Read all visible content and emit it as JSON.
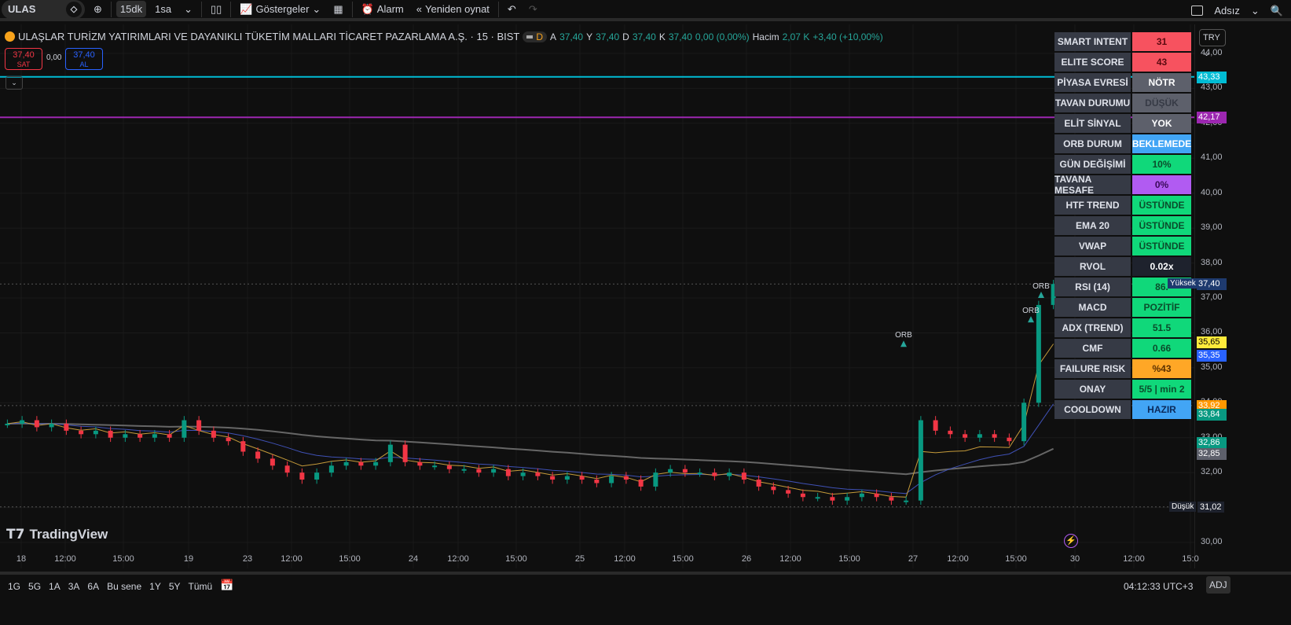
{
  "toolbar": {
    "symbol": "ULAS",
    "interval_active": "15dk",
    "interval_2": "1sa",
    "indicators": "Göstergeler",
    "alarm": "Alarm",
    "replay": "Yeniden oynat",
    "layout_name": "Adsız"
  },
  "legend": {
    "title": "ULAŞLAR TURİZM YATIRIMLARI VE DAYANIKLI TÜKETİM MALLARI TİCARET PAZARLAMA A.Ş. · 15 · BIST",
    "d_badge": "D",
    "o_label": "A",
    "o": "37,40",
    "h_label": "Y",
    "h": "37,40",
    "l_label": "D",
    "l": "37,40",
    "c_label": "K",
    "c": "37,40",
    "change": "0,00 (0,00%)",
    "vol_label": "Hacim",
    "vol": "2,07 K",
    "vol_change": "+3,40 (+10,00%)"
  },
  "trade": {
    "sell_price": "37,40",
    "sell_label": "SAT",
    "spread": "0,00",
    "buy_price": "37,40",
    "buy_label": "AL"
  },
  "currency": "TRY",
  "table": [
    {
      "k": "SMART INTENT",
      "v": "31",
      "bg": "#f7525f",
      "fg": "#5a0a10"
    },
    {
      "k": "ELITE SCORE",
      "v": "43",
      "bg": "#f7525f",
      "fg": "#5a0a10"
    },
    {
      "k": "PİYASA EVRESİ",
      "v": "NÖTR",
      "bg": "#5d606b",
      "fg": "#ffffff"
    },
    {
      "k": "TAVAN DURUMU",
      "v": "DÜŞÜK",
      "bg": "#5d606b",
      "fg": "#363a45"
    },
    {
      "k": "ELİT SİNYAL",
      "v": "YOK",
      "bg": "#5d606b",
      "fg": "#ffffff"
    },
    {
      "k": "ORB DURUM",
      "v": "BEKLEMEDE",
      "bg": "#42a5f5",
      "fg": "#ffffff"
    },
    {
      "k": "GÜN DEĞİŞİMİ",
      "v": "10%",
      "bg": "#10d87a",
      "fg": "#0b4d2c"
    },
    {
      "k": "TAVANA MESAFE",
      "v": "0%",
      "bg": "#b15bf2",
      "fg": "#3a0a5a"
    },
    {
      "k": "HTF TREND",
      "v": "ÜSTÜNDE",
      "bg": "#10d87a",
      "fg": "#0b4d2c"
    },
    {
      "k": "EMA 20",
      "v": "ÜSTÜNDE",
      "bg": "#10d87a",
      "fg": "#0b4d2c"
    },
    {
      "k": "VWAP",
      "v": "ÜSTÜNDE",
      "bg": "#10d87a",
      "fg": "#0b4d2c"
    },
    {
      "k": "RVOL",
      "v": "0.02x",
      "bg": "#1e222d",
      "fg": "#ffffff"
    },
    {
      "k": "RSI (14)",
      "v": "86.",
      "bg": "#10d87a",
      "fg": "#0b4d2c"
    },
    {
      "k": "MACD",
      "v": "POZİTİF",
      "bg": "#10d87a",
      "fg": "#0b4d2c"
    },
    {
      "k": "ADX (TREND)",
      "v": "51.5",
      "bg": "#10d87a",
      "fg": "#0b4d2c"
    },
    {
      "k": "CMF",
      "v": "0.66",
      "bg": "#10d87a",
      "fg": "#0b4d2c"
    },
    {
      "k": "FAILURE RISK",
      "v": "%43",
      "bg": "#ffa726",
      "fg": "#5a3000"
    },
    {
      "k": "ONAY",
      "v": "5/5 | min 2",
      "bg": "#10d87a",
      "fg": "#0b4d2c"
    },
    {
      "k": "COOLDOWN",
      "v": "HAZIR",
      "bg": "#42a5f5",
      "fg": "#0b2a5a"
    }
  ],
  "price_ticks": [
    "44,00",
    "43,00",
    "42,00",
    "41,00",
    "40,00",
    "39,00",
    "38,00",
    "37,00",
    "36,00",
    "35,00",
    "34,00",
    "33,00",
    "32,00",
    "31,00",
    "30,00"
  ],
  "price_labels": [
    {
      "p": 43.33,
      "text": "43,33",
      "color": "#00bcd4"
    },
    {
      "p": 42.17,
      "text": "42,17",
      "color": "#9c27b0"
    },
    {
      "p": 37.4,
      "text": "37,40",
      "color": "#1e3a6e"
    },
    {
      "p": 35.75,
      "text": "35,65",
      "color": "#ffeb3b"
    },
    {
      "p": 35.35,
      "text": "35,35",
      "color": "#2962ff"
    },
    {
      "p": 33.92,
      "text": "33,92",
      "color": "#ff9800"
    },
    {
      "p": 33.68,
      "text": "33,84",
      "color": "#089981"
    },
    {
      "p": 32.86,
      "text": "32,86",
      "color": "#089981"
    },
    {
      "p": 32.55,
      "text": "32,85",
      "color": "#5d606b"
    }
  ],
  "high_tag": "Yüksek",
  "low_tag": "Düşük",
  "low_price": "31,02",
  "low_value": 31.02,
  "high_value": 37.4,
  "x_ticks": [
    "18",
    "12:00",
    "15:00",
    "19",
    "23",
    "12:00",
    "15:00",
    "24",
    "12:00",
    "15:00",
    "25",
    "12:00",
    "15:00",
    "26",
    "12:00",
    "15:00",
    "27",
    "12:00",
    "15:00",
    "30",
    "12:00",
    "15:0"
  ],
  "orb_label": "ORB",
  "closes": [
    33.4,
    33.5,
    33.3,
    33.4,
    33.2,
    33.1,
    33.2,
    33.0,
    33.1,
    33.0,
    33.1,
    33.0,
    33.5,
    33.2,
    33.0,
    32.9,
    32.6,
    32.4,
    32.2,
    32.0,
    31.8,
    32.0,
    32.2,
    32.3,
    32.2,
    32.3,
    32.8,
    32.3,
    32.2,
    32.2,
    32.1,
    32.1,
    32.0,
    32.1,
    31.9,
    32.0,
    31.9,
    31.8,
    31.9,
    31.8,
    31.7,
    31.9,
    31.8,
    31.6,
    32.0,
    32.1,
    32.0,
    32.0,
    31.9,
    32.0,
    31.8,
    31.6,
    31.5,
    31.4,
    31.3,
    31.3,
    31.2,
    31.3,
    31.4,
    31.3,
    31.2,
    31.2,
    33.5,
    33.2,
    33.1,
    33.0,
    33.1,
    33.0,
    32.9,
    34.0,
    36.8,
    37.4
  ],
  "bottom": {
    "ranges": [
      "1G",
      "5G",
      "1A",
      "3A",
      "6A",
      "Bu sene",
      "1Y",
      "5Y",
      "Tümü"
    ],
    "clock": "04:12:33 UTC+3",
    "adj": "ADJ"
  },
  "brand": "TradingView",
  "colors": {
    "up": "#089981",
    "down": "#f23645"
  }
}
